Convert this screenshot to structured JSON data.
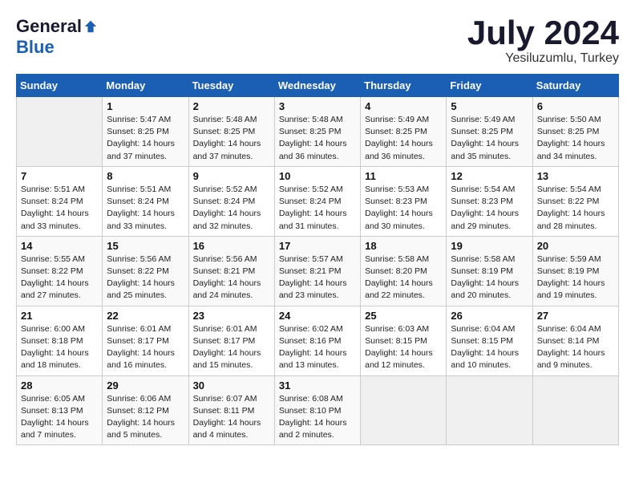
{
  "logo": {
    "general": "General",
    "blue": "Blue"
  },
  "header": {
    "month": "July 2024",
    "location": "Yesiluzumlu, Turkey"
  },
  "weekdays": [
    "Sunday",
    "Monday",
    "Tuesday",
    "Wednesday",
    "Thursday",
    "Friday",
    "Saturday"
  ],
  "weeks": [
    [
      {
        "day": "",
        "info": ""
      },
      {
        "day": "1",
        "info": "Sunrise: 5:47 AM\nSunset: 8:25 PM\nDaylight: 14 hours\nand 37 minutes."
      },
      {
        "day": "2",
        "info": "Sunrise: 5:48 AM\nSunset: 8:25 PM\nDaylight: 14 hours\nand 37 minutes."
      },
      {
        "day": "3",
        "info": "Sunrise: 5:48 AM\nSunset: 8:25 PM\nDaylight: 14 hours\nand 36 minutes."
      },
      {
        "day": "4",
        "info": "Sunrise: 5:49 AM\nSunset: 8:25 PM\nDaylight: 14 hours\nand 36 minutes."
      },
      {
        "day": "5",
        "info": "Sunrise: 5:49 AM\nSunset: 8:25 PM\nDaylight: 14 hours\nand 35 minutes."
      },
      {
        "day": "6",
        "info": "Sunrise: 5:50 AM\nSunset: 8:25 PM\nDaylight: 14 hours\nand 34 minutes."
      }
    ],
    [
      {
        "day": "7",
        "info": "Sunrise: 5:51 AM\nSunset: 8:24 PM\nDaylight: 14 hours\nand 33 minutes."
      },
      {
        "day": "8",
        "info": "Sunrise: 5:51 AM\nSunset: 8:24 PM\nDaylight: 14 hours\nand 33 minutes."
      },
      {
        "day": "9",
        "info": "Sunrise: 5:52 AM\nSunset: 8:24 PM\nDaylight: 14 hours\nand 32 minutes."
      },
      {
        "day": "10",
        "info": "Sunrise: 5:52 AM\nSunset: 8:24 PM\nDaylight: 14 hours\nand 31 minutes."
      },
      {
        "day": "11",
        "info": "Sunrise: 5:53 AM\nSunset: 8:23 PM\nDaylight: 14 hours\nand 30 minutes."
      },
      {
        "day": "12",
        "info": "Sunrise: 5:54 AM\nSunset: 8:23 PM\nDaylight: 14 hours\nand 29 minutes."
      },
      {
        "day": "13",
        "info": "Sunrise: 5:54 AM\nSunset: 8:22 PM\nDaylight: 14 hours\nand 28 minutes."
      }
    ],
    [
      {
        "day": "14",
        "info": "Sunrise: 5:55 AM\nSunset: 8:22 PM\nDaylight: 14 hours\nand 27 minutes."
      },
      {
        "day": "15",
        "info": "Sunrise: 5:56 AM\nSunset: 8:22 PM\nDaylight: 14 hours\nand 25 minutes."
      },
      {
        "day": "16",
        "info": "Sunrise: 5:56 AM\nSunset: 8:21 PM\nDaylight: 14 hours\nand 24 minutes."
      },
      {
        "day": "17",
        "info": "Sunrise: 5:57 AM\nSunset: 8:21 PM\nDaylight: 14 hours\nand 23 minutes."
      },
      {
        "day": "18",
        "info": "Sunrise: 5:58 AM\nSunset: 8:20 PM\nDaylight: 14 hours\nand 22 minutes."
      },
      {
        "day": "19",
        "info": "Sunrise: 5:58 AM\nSunset: 8:19 PM\nDaylight: 14 hours\nand 20 minutes."
      },
      {
        "day": "20",
        "info": "Sunrise: 5:59 AM\nSunset: 8:19 PM\nDaylight: 14 hours\nand 19 minutes."
      }
    ],
    [
      {
        "day": "21",
        "info": "Sunrise: 6:00 AM\nSunset: 8:18 PM\nDaylight: 14 hours\nand 18 minutes."
      },
      {
        "day": "22",
        "info": "Sunrise: 6:01 AM\nSunset: 8:17 PM\nDaylight: 14 hours\nand 16 minutes."
      },
      {
        "day": "23",
        "info": "Sunrise: 6:01 AM\nSunset: 8:17 PM\nDaylight: 14 hours\nand 15 minutes."
      },
      {
        "day": "24",
        "info": "Sunrise: 6:02 AM\nSunset: 8:16 PM\nDaylight: 14 hours\nand 13 minutes."
      },
      {
        "day": "25",
        "info": "Sunrise: 6:03 AM\nSunset: 8:15 PM\nDaylight: 14 hours\nand 12 minutes."
      },
      {
        "day": "26",
        "info": "Sunrise: 6:04 AM\nSunset: 8:15 PM\nDaylight: 14 hours\nand 10 minutes."
      },
      {
        "day": "27",
        "info": "Sunrise: 6:04 AM\nSunset: 8:14 PM\nDaylight: 14 hours\nand 9 minutes."
      }
    ],
    [
      {
        "day": "28",
        "info": "Sunrise: 6:05 AM\nSunset: 8:13 PM\nDaylight: 14 hours\nand 7 minutes."
      },
      {
        "day": "29",
        "info": "Sunrise: 6:06 AM\nSunset: 8:12 PM\nDaylight: 14 hours\nand 5 minutes."
      },
      {
        "day": "30",
        "info": "Sunrise: 6:07 AM\nSunset: 8:11 PM\nDaylight: 14 hours\nand 4 minutes."
      },
      {
        "day": "31",
        "info": "Sunrise: 6:08 AM\nSunset: 8:10 PM\nDaylight: 14 hours\nand 2 minutes."
      },
      {
        "day": "",
        "info": ""
      },
      {
        "day": "",
        "info": ""
      },
      {
        "day": "",
        "info": ""
      }
    ]
  ]
}
